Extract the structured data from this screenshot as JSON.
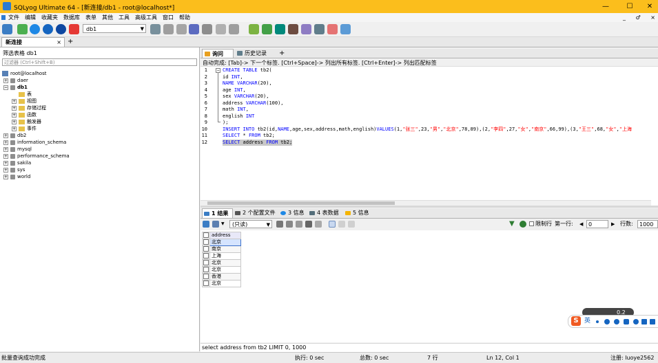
{
  "window": {
    "title": "SQLyog Ultimate 64 - [新连接/db1 - root@localhost*]",
    "min_label": "—",
    "max_label": "☐",
    "close_label": "✕"
  },
  "menu": {
    "items": [
      "文件",
      "编辑",
      "收藏夹",
      "数据库",
      "表单",
      "其他",
      "工具",
      "高级工具",
      "窗口",
      "帮助"
    ],
    "right_controls": [
      "_",
      "♂",
      "×"
    ]
  },
  "toolbar": {
    "db_selected": "db1"
  },
  "connection": {
    "tab_label": "新连接",
    "close": "×",
    "add": "+"
  },
  "object_browser": {
    "filter_label": "筛选表格 db1",
    "filter_placeholder": "过滤器 (Ctrl+Shift+B)",
    "server": "root@localhost",
    "databases": [
      {
        "name": "daer",
        "expanded": false
      },
      {
        "name": "db1",
        "expanded": true,
        "children": [
          "表",
          "视图",
          "存储过程",
          "函数",
          "触发器",
          "事件"
        ]
      },
      {
        "name": "db2",
        "expanded": false
      },
      {
        "name": "information_schema",
        "expanded": false
      },
      {
        "name": "mysql",
        "expanded": false
      },
      {
        "name": "performance_schema",
        "expanded": false
      },
      {
        "name": "sakila",
        "expanded": false
      },
      {
        "name": "sys",
        "expanded": false
      },
      {
        "name": "world",
        "expanded": false
      }
    ]
  },
  "editor": {
    "tabs": [
      "询问",
      "历史记录"
    ],
    "add_tab": "+",
    "hint": "自动完成: [Tab]-> 下一个标签. [Ctrl+Space]-> 列出所有标签. [Ctrl+Enter]-> 列出匹配标签",
    "line_numbers": [
      "1",
      "2",
      "3",
      "4",
      "5",
      "6",
      "7",
      "8",
      "9",
      "10",
      "11",
      "12"
    ],
    "lines": {
      "l1_kw": "CREATE TABLE",
      "l1_rest": " tb2(",
      "l2_a": "id ",
      "l2_kw": "INT",
      "l2_b": ",",
      "l3_kw": "NAME VARCHAR",
      "l3_b": "(20),",
      "l4_a": "age ",
      "l4_kw": "INT",
      "l4_b": ",",
      "l5_a": "sex ",
      "l5_kw": "VARCHAR",
      "l5_b": "(20),",
      "l6_a": "address ",
      "l6_kw": "VARCHAR",
      "l6_b": "(100),",
      "l7_a": "math ",
      "l7_kw": "INT",
      "l7_b": ",",
      "l8_a": "english ",
      "l8_kw": "INT",
      "l9": ");",
      "l10_kw1": "INSERT INTO",
      "l10_a": " tb2(id,",
      "l10_kw2": "NAME",
      "l10_b": ",age,sex,address,math,english)",
      "l10_kw3": "VALUES",
      "l10_c": "(1,",
      "l10_s1": "\"张三\"",
      "l10_d": ",23,",
      "l10_s2": "\"男\"",
      "l10_e": ",",
      "l10_s3": "\"北京\"",
      "l10_f": ",78,89),(2,",
      "l10_s4": "\"李四\"",
      "l10_g": ",27,",
      "l10_s5": "\"女\"",
      "l10_h": ",",
      "l10_s6": "\"南京\"",
      "l10_i": ",66,99),(3,",
      "l10_s7": "\"王三\"",
      "l10_j": ",68,",
      "l10_s8": "\"女\"",
      "l10_k": ",",
      "l10_s9": "\"上海",
      "l11_kw1": "SELECT",
      "l11_a": " * ",
      "l11_kw2": "FROM",
      "l11_b": " tb2;",
      "l12_kw1": "SELECT",
      "l12_a": " address ",
      "l12_kw2": "FROM",
      "l12_b": " tb2;"
    }
  },
  "results": {
    "tabs": [
      "1 结果",
      "2 个配置文件",
      "3 信息",
      "4 表数据",
      "5 信息"
    ],
    "mode_select": "(只读)",
    "limit_label": "限制行",
    "first_row_label": "第一行:",
    "first_row_value": "0",
    "rows_label": "行数:",
    "rows_value": "1000",
    "column_header": "address",
    "rows": [
      "北京",
      "南京",
      "上海",
      "北京",
      "北京",
      "香港",
      "北京"
    ],
    "query": "select address from tb2 LIMIT 0, 1000"
  },
  "status": {
    "left": "批量查询成功完成",
    "exec": "执行: 0 sec",
    "total": "总数: 0 sec",
    "rows": "7 行",
    "pos": "Ln 12, Col 1",
    "user": "注册: luoye2562"
  },
  "ime": {
    "logo": "S",
    "lang": "英",
    "net": "0.2"
  },
  "colors": {
    "titlebar": "#fbbe1c",
    "keyword": "#0000ff",
    "string": "#ff0000"
  }
}
